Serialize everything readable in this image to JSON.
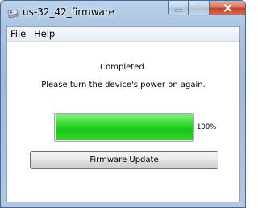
{
  "window": {
    "title": "us-32_42_firmware",
    "app_icon": "app-icon",
    "caption_buttons": [
      "minimize-icon",
      "maximize-icon",
      "close-icon"
    ]
  },
  "menu": {
    "file": "File",
    "help": "Help"
  },
  "status": {
    "line1": "Completed.",
    "line2": "Please turn the device's power on again."
  },
  "progress": {
    "value": 1.0,
    "label": "100%",
    "color": "#17c613"
  },
  "buttons": {
    "firmware_update": "Firmware Update"
  }
}
